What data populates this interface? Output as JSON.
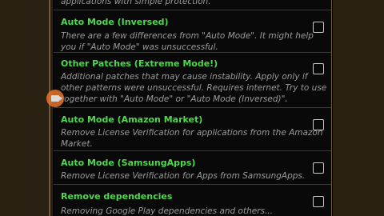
{
  "options": [
    {
      "title": "",
      "description": [
        "applications with simple protection."
      ],
      "checked": false
    },
    {
      "title": "Auto Mode (Inversed)",
      "description": [
        "There are a few differences from \"Auto Mode\". It might help",
        "you if \"Auto Mode\" was unsuccessful."
      ],
      "checked": false
    },
    {
      "title": "Other Patches (Extreme Mode!)",
      "description": [
        "Additional patches that may cause instability. Apply only if",
        "other patterns were unsuccessful. Requires internet. Try to use",
        "together with \"Auto Mode\" or \"Auto Mode (Inversed)\"."
      ],
      "checked": false
    },
    {
      "title": "Auto Mode (Amazon Market)",
      "description": [
        "Remove License Verification for applications from the Amazon",
        "Market."
      ],
      "checked": false
    },
    {
      "title": "Auto Mode (SamsungApps)",
      "description": [
        "Remove License Verification for Apps from SamsungApps."
      ],
      "checked": false
    },
    {
      "title": "Remove dependencies",
      "description": [
        "Removing Google Play dependencies and others..."
      ],
      "checked": false
    }
  ],
  "colors": {
    "title_green": "#4cd94c",
    "description_grey": "#9a9a9a",
    "list_background": "#090909",
    "side_background": "#2a2113"
  },
  "overlay": {
    "icon": "video-camera-icon"
  }
}
